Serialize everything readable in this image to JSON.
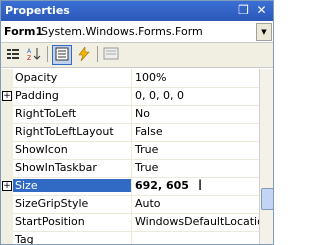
{
  "window": {
    "title": "Properties",
    "pin_glyph": "❒",
    "close_glyph": "✕"
  },
  "object": {
    "name": "Form1",
    "type": "System.Windows.Forms.Form"
  },
  "toolbar": {
    "buttons": [
      "categorized",
      "alphabetical",
      "properties",
      "events",
      "property-pages"
    ]
  },
  "properties": [
    {
      "name": "Opacity",
      "value": "100%",
      "expand": false,
      "selected": false
    },
    {
      "name": "Padding",
      "value": "0, 0, 0, 0",
      "expand": true,
      "selected": false
    },
    {
      "name": "RightToLeft",
      "value": "No",
      "expand": false,
      "selected": false
    },
    {
      "name": "RightToLeftLayout",
      "value": "False",
      "expand": false,
      "selected": false
    },
    {
      "name": "ShowIcon",
      "value": "True",
      "expand": false,
      "selected": false
    },
    {
      "name": "ShowInTaskbar",
      "value": "True",
      "expand": false,
      "selected": false
    },
    {
      "name": "Size",
      "value": "692, 605",
      "expand": true,
      "selected": true
    },
    {
      "name": "SizeGripStyle",
      "value": "Auto",
      "expand": false,
      "selected": false
    },
    {
      "name": "StartPosition",
      "value": "WindowsDefaultLocation",
      "expand": false,
      "selected": false
    },
    {
      "name": "Tag",
      "value": "",
      "expand": false,
      "selected": false
    }
  ],
  "colors": {
    "titlebar": "#2a58b8",
    "selection": "#316ac5"
  }
}
